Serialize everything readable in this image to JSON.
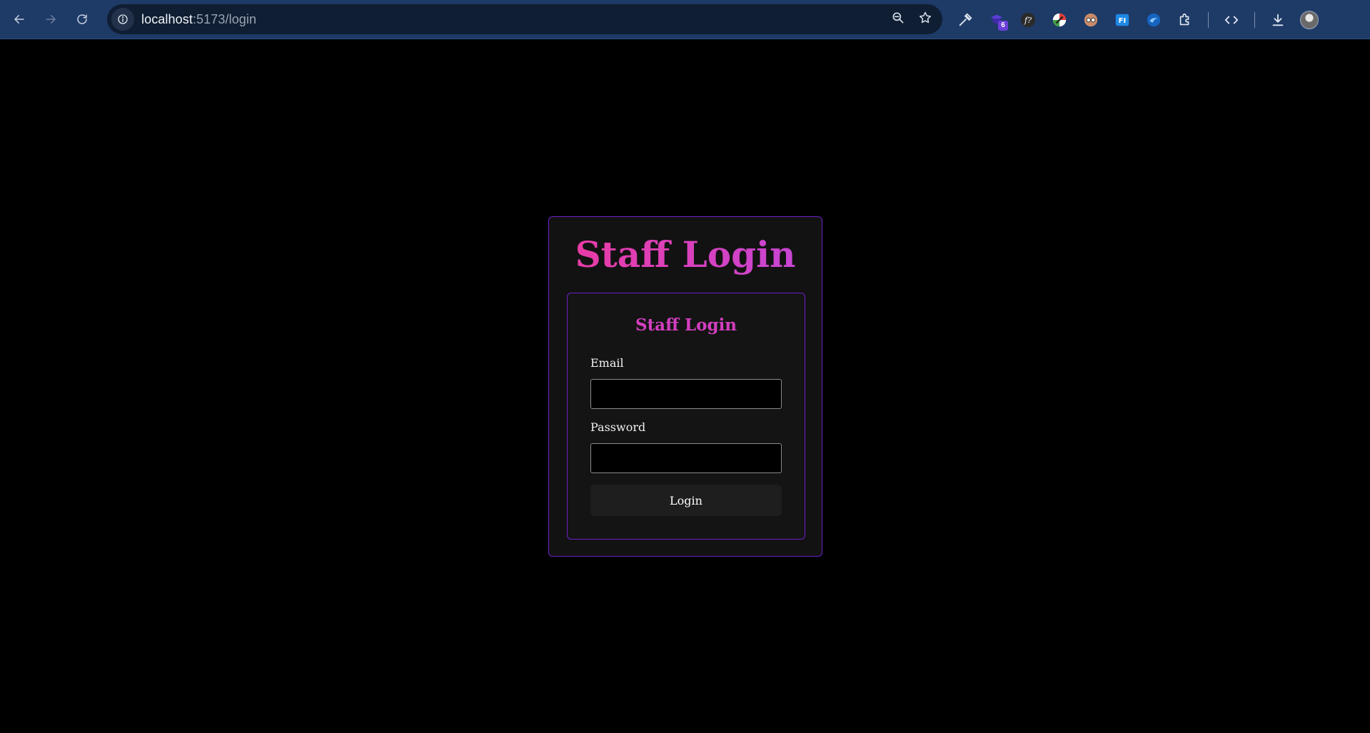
{
  "browser": {
    "url_host": "localhost",
    "url_path": ":5173/login",
    "extension_badge": "6"
  },
  "page": {
    "title": "Staff Login",
    "form": {
      "title": "Staff Login",
      "email_label": "Email",
      "email_value": "",
      "password_label": "Password",
      "password_value": "",
      "submit_label": "Login"
    }
  },
  "colors": {
    "background": "#000000",
    "card": "#121212",
    "border_accent": "#6c1fc9",
    "title_gradient_start": "#ec3ba0",
    "title_gradient_end": "#c446d8",
    "form_title": "#d43fc0",
    "button_bg": "#1e1e1e"
  },
  "icons": {
    "toolbar": [
      "back-arrow-icon",
      "forward-arrow-icon",
      "reload-icon",
      "site-info-icon",
      "zoom-icon",
      "bookmark-star-icon"
    ],
    "extensions": [
      "eyedropper-icon",
      "extension-badge-icon",
      "font-identifier-icon",
      "color-extension-icon",
      "spy-extension-icon",
      "fi-extension-icon",
      "blue-extension-icon",
      "puzzle-icon",
      "code-icon",
      "download-icon",
      "profile-avatar"
    ]
  }
}
